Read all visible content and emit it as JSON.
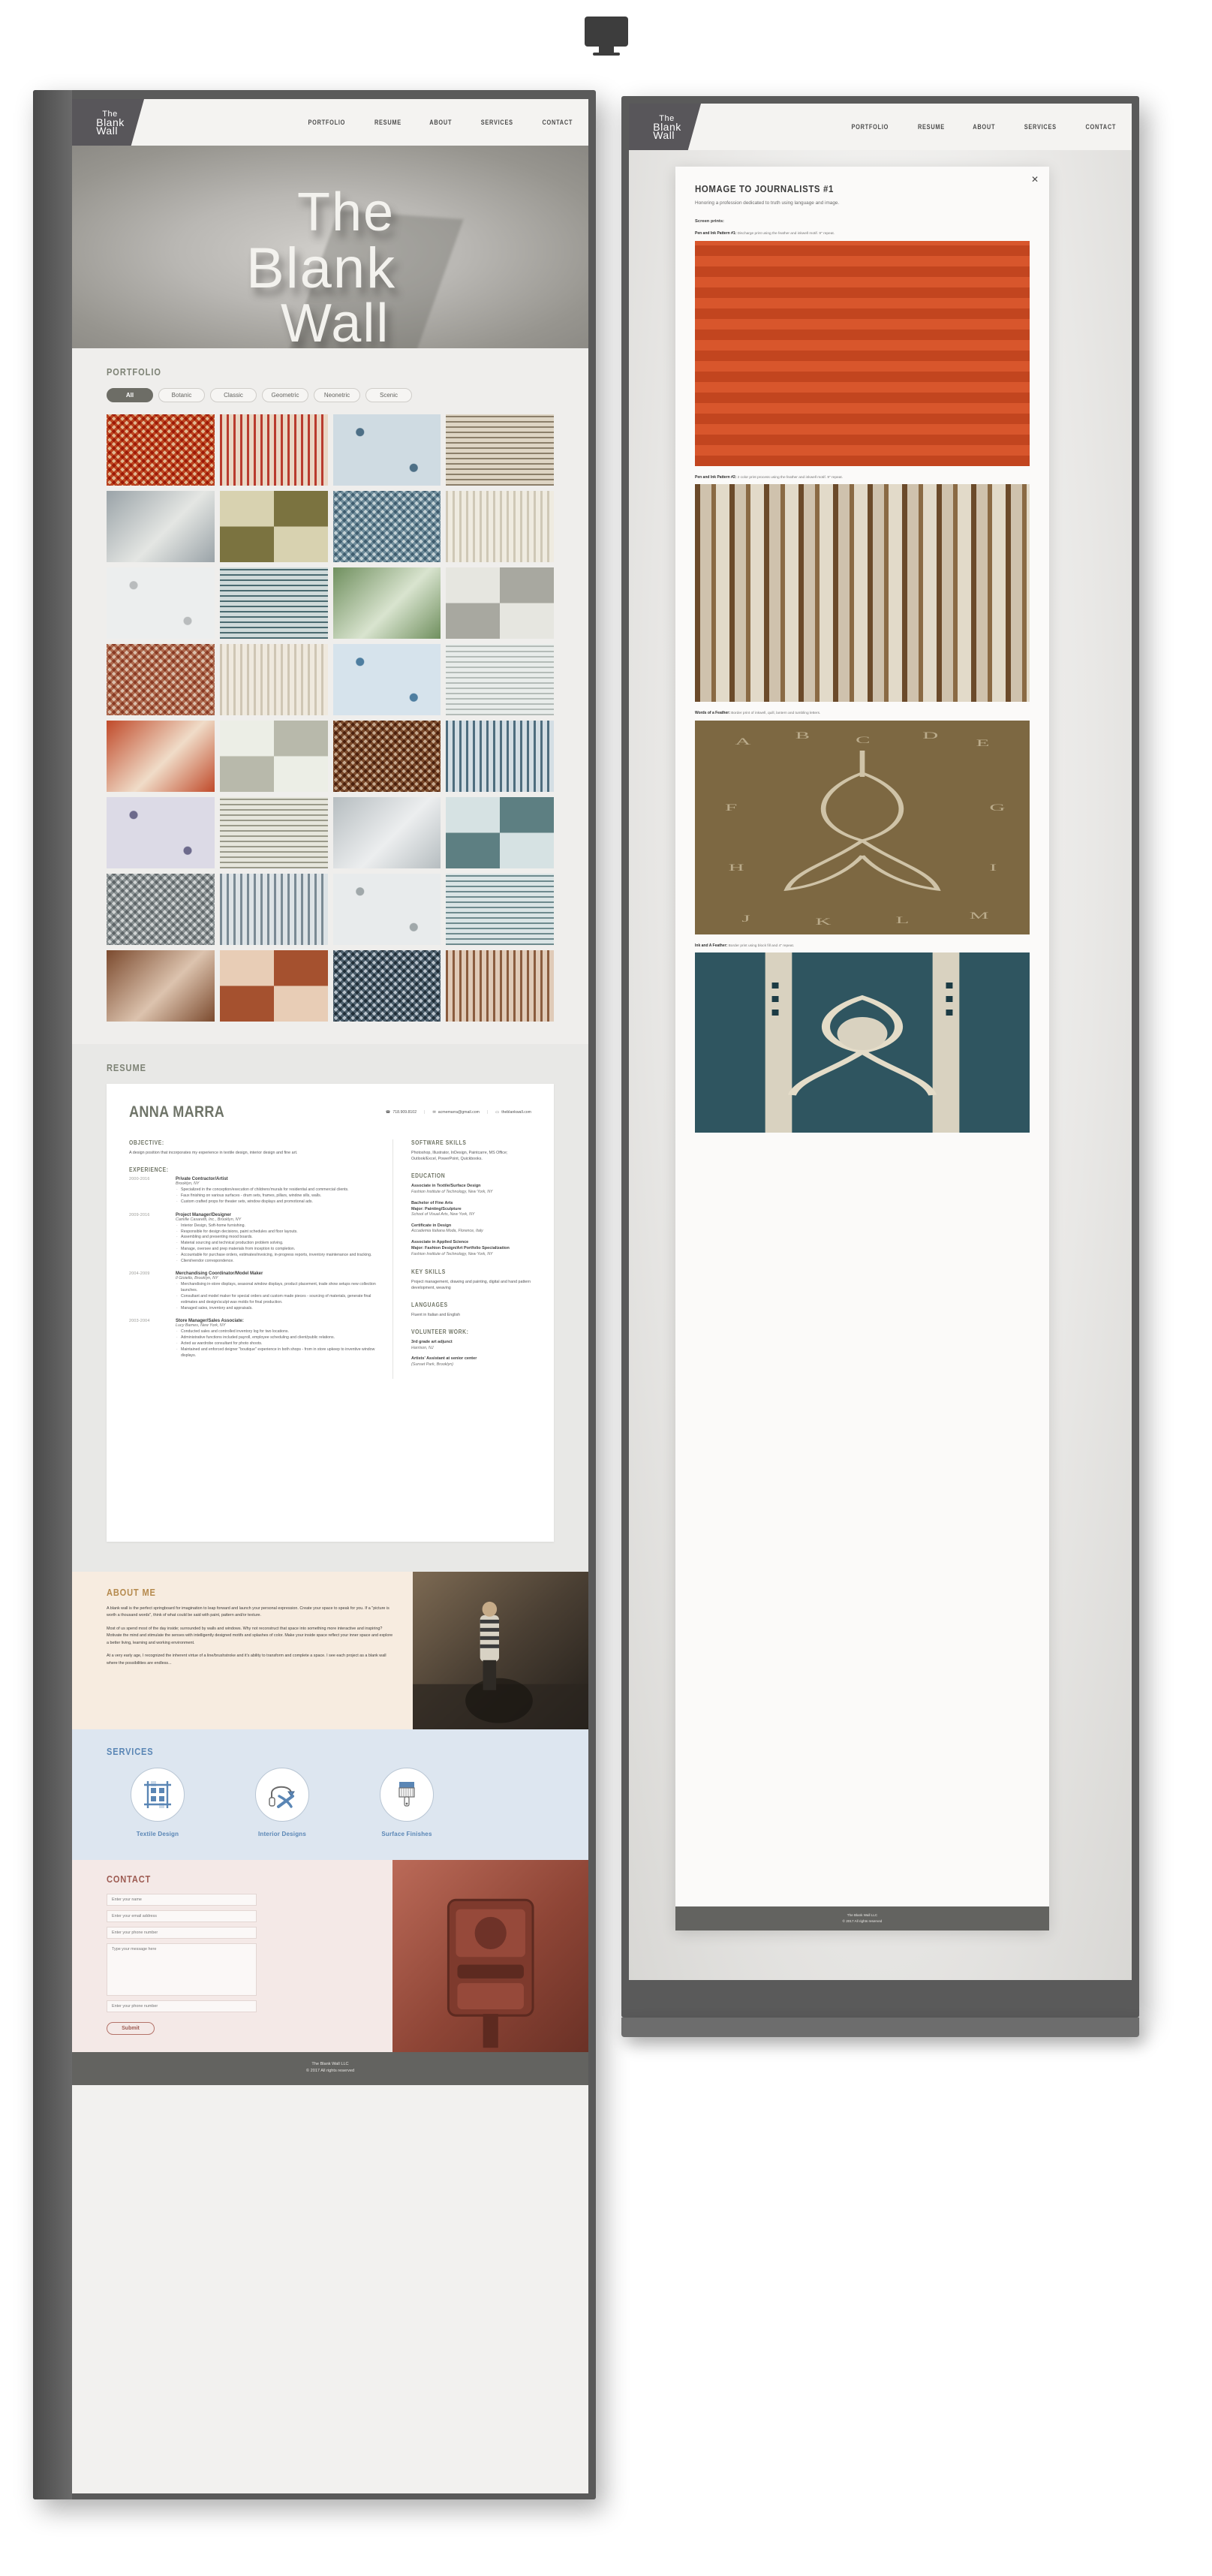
{
  "top_icon": {
    "name": "desktop-monitor-icon"
  },
  "site": {
    "logo": {
      "line1": "The",
      "line2": "Blank",
      "line3": "Wall"
    },
    "nav": [
      {
        "label": "PORTFOLIO"
      },
      {
        "label": "RESUME"
      },
      {
        "label": "ABOUT"
      },
      {
        "label": "SERVICES"
      },
      {
        "label": "CONTACT"
      }
    ],
    "hero": {
      "word1": "The",
      "word2": "Blank",
      "word3": "Wall"
    },
    "footer": {
      "line1": "The Blank Wall LLC",
      "line2": "© 2017 All rights reserved"
    }
  },
  "portfolio": {
    "title": "PORTFOLIO",
    "filters": [
      {
        "label": "All",
        "active": true
      },
      {
        "label": "Botanic",
        "active": false
      },
      {
        "label": "Classic",
        "active": false
      },
      {
        "label": "Geometric",
        "active": false
      },
      {
        "label": "Neonetric",
        "active": false
      },
      {
        "label": "Scenic",
        "active": false
      }
    ],
    "tile_count": 32
  },
  "resume": {
    "title": "RESUME",
    "name": "ANNA MARRA",
    "contacts": [
      {
        "icon": "phone-icon",
        "text": "718.909.8102"
      },
      {
        "icon": "envelope-icon",
        "text": "acmemarra@gmail.com"
      },
      {
        "icon": "monitor-icon",
        "text": "theblankwall.com"
      }
    ],
    "objective_heading": "OBJECTIVE:",
    "objective_text": "A design position that incorporates my experience in textile design, interior design and fine art.",
    "experience_heading": "EXPERIENCE:",
    "jobs": [
      {
        "dates": "2000-2016",
        "title": "Private Contractor/Artist",
        "org": "Brooklyn, NY",
        "bullets": [
          "Specialized in the conception/execution of childrens'murals for residential and commercial clients.",
          "Faux finishing on various surfaces - drum sets, frames, pillars, window sills, walls.",
          "Custom crafted props for theater sets, window displays and promotional ads."
        ]
      },
      {
        "dates": "2009-2016",
        "title": "Project Manager/Designer",
        "org": "Camille Casaretti, Inc., Brooklyn, NY",
        "bullets": [
          "Interior Design, Soft-home furnishing.",
          "Responsible for design decisions, paint schedules and floor layouts.",
          "Assembling and presenting mood boards.",
          "Material sourcing and technical production problem solving.",
          "Manage, oversee and prep materials from inception to completion.",
          "Accountable for purchase orders, estimates/invoicing, in-progress reports, inventory maintenance and tracking.",
          "Client/vendor correspondence."
        ]
      },
      {
        "dates": "2004-2009",
        "title": "Merchandising Coordinator/Model Maker",
        "org": "Il Gioiello, Brooklyn, NY",
        "bullets": [
          "Merchandising in-store displays, seasonal window displays, product placement, trade show setups new collection launches.",
          "Consultant and model maker for special orders and custom made pieces - sourcing of materials, generate final estimates and design/sculpt wax molds for final production.",
          "Managed sales, inventory and appraisals."
        ]
      },
      {
        "dates": "2003-2004",
        "title": "Store Manager/Sales Associate:",
        "org": "Lucy Barnes, New York, NY",
        "bullets": [
          "Conducted sales and controlled inventory log for two locations.",
          "Administrative functions included payroll, employee scheduling and client/public relations.",
          "Acted as wardrobe consultant for photo shoots.",
          "Maintained and enforced deigner \"boutique\" experience in both shops - from in store upkeep to inventive window displays."
        ]
      }
    ],
    "software_heading": "SOFTWARE SKILLS",
    "software_text": "Photoshop, Illustrator, InDesign, Paintcarre, MS Office; Outlook/Excel, PowerPoint, Quickbooks.",
    "education_heading": "EDUCATION",
    "education": [
      {
        "degree": "Associate in Textile/Surface Design",
        "school": "Fashion Institute of Technology, New York, NY"
      },
      {
        "degree": "Bachelor of Fine Arts\nMajor: Painting/Sculpture",
        "school": "School of Visual Arts, New York, NY"
      },
      {
        "degree": "Certificate in Design",
        "school": "Accademia Italiana Moda, Florence, Italy"
      },
      {
        "degree": "Associate in Applied Science\nMajor: Fashion Design/Art Portfolio Specialization",
        "school": "Fashion Institute of Technology, New York, NY"
      }
    ],
    "key_skills_heading": "KEY SKILLS",
    "key_skills_text": "Project management, drawing and painting, digital and hand pattern development, weaving",
    "languages_heading": "LANGUAGES",
    "languages_text": "Fluent in Italian and English",
    "volunteer_heading": "VOLUNTEER WORK:",
    "volunteer": [
      {
        "role": "3rd grade art adjunct",
        "place": "Harrison, NJ"
      },
      {
        "role": "Artists' Assistant at senior center",
        "place": "(Sunset Park, Brooklyn)"
      }
    ]
  },
  "about": {
    "title": "ABOUT ME",
    "paragraphs": [
      "A blank wall is the perfect springboard for imagination to leap forward and launch your personal expression. Create your space to speak for you. If a \"picture is worth a thousand words\", think of what could be said with paint, pattern and/or texture.",
      "Most of us spend most of the day inside; surrounded by walls and windows. Why not reconstruct that space into something more interactive and inspiring? Motivate the mind and stimulate the senses with intelligently designed motifs and splashes of color. Make your inside space reflect your inner space and explore a better living, learning and working environment.",
      "At a very early age, I recognized the inherent virtue of a line/brushstroke and it's ability to transform and complete a space. I see each project as a blank wall where the possibilities are endless..."
    ],
    "image_name": "about-photo-figure-on-wall"
  },
  "services": {
    "title": "SERVICES",
    "items": [
      {
        "label": "Textile Design",
        "icon": "plaid-weave-icon"
      },
      {
        "label": "Interior Designs",
        "icon": "lamp-chair-icon"
      },
      {
        "label": "Surface Finishes",
        "icon": "paintbrush-icon"
      }
    ]
  },
  "contact": {
    "title": "CONTACT",
    "fields": [
      {
        "name": "name",
        "placeholder": "Enter your name",
        "value": ""
      },
      {
        "name": "email",
        "placeholder": "Enter your email address",
        "value": ""
      },
      {
        "name": "phone",
        "placeholder": "Enter your phone number",
        "value": ""
      }
    ],
    "message_placeholder": "Type your message here",
    "message_value": "",
    "extra_field": {
      "placeholder": "Enter your phone number",
      "value": ""
    },
    "submit_label": "Submit",
    "image_name": "contact-photo-red-mailbox"
  },
  "modal": {
    "title": "HOMAGE TO JOURNALISTS #1",
    "subtitle": "Honoring a profession dedicated to truth using language and image.",
    "kicker": "Screen prints:",
    "items": [
      {
        "label": "Pen and Ink Pattern #1:",
        "desc": "Discharge print using the feather and inkwell motif. 9\" repeat.",
        "swatch": "orange-ikat"
      },
      {
        "label": "Pen and Ink Pattern #2:",
        "desc": "2 color print process using the feather and inkwell motif. 9\" repeat.",
        "swatch": "brown-stripe"
      },
      {
        "label": "Words of a Feather:",
        "desc": "Border print of inkwell, quill, lantern and tumbling letters.",
        "swatch": "sepia-scroll"
      },
      {
        "label": "Ink and A Feather:",
        "desc": "Border print using block fill and 4\" repeat.",
        "swatch": "teal-border"
      }
    ],
    "close_icon": "close-icon",
    "footer": {
      "line1": "The Blank Wall LLC",
      "line2": "© 2017 All rights reserved"
    }
  }
}
